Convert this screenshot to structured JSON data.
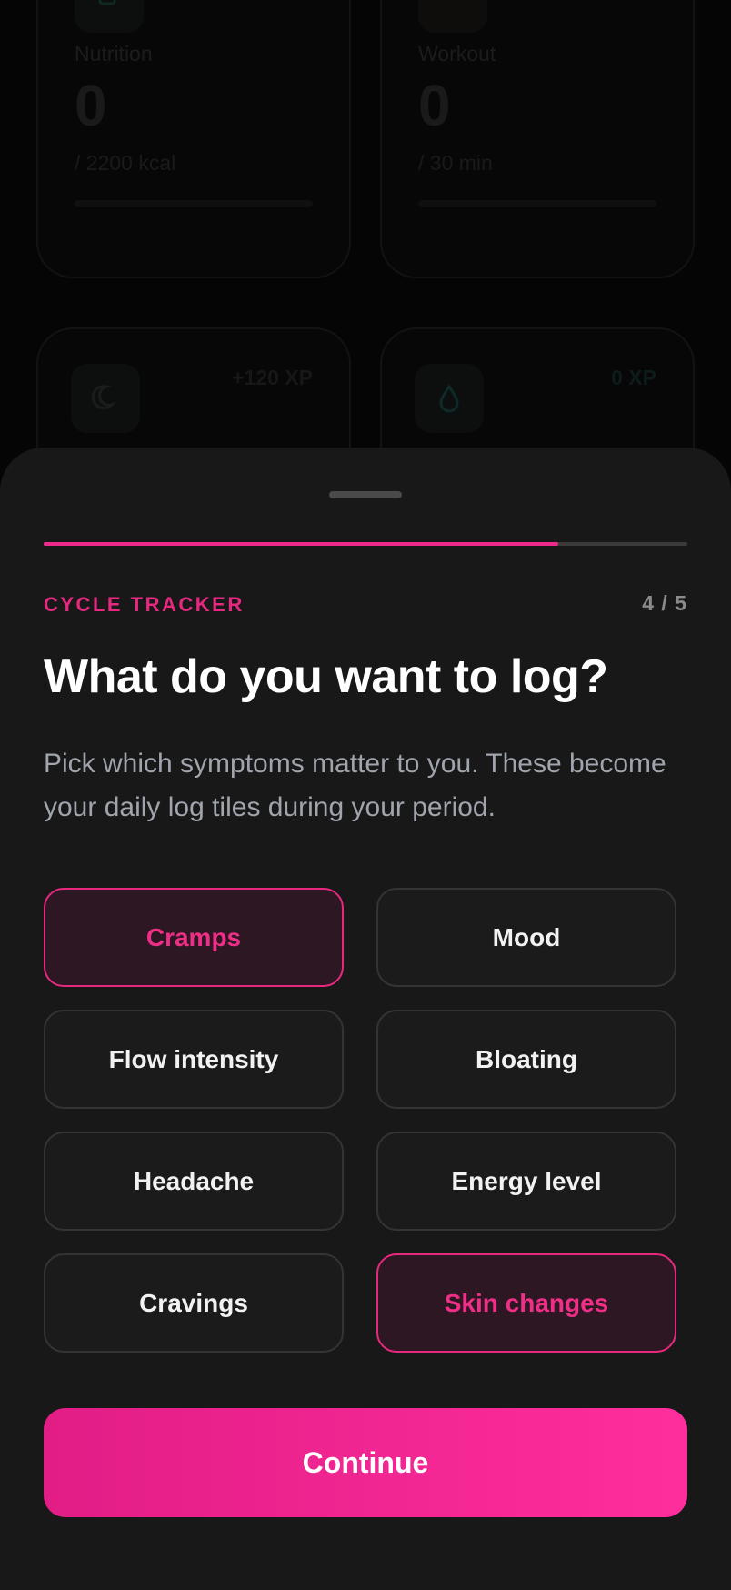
{
  "background": {
    "cards": [
      {
        "label": "Nutrition",
        "value": "0",
        "goal": "/ 2200 kcal",
        "icon": "cup-icon"
      },
      {
        "label": "Workout",
        "value": "0",
        "goal": "/ 30 min",
        "icon": "dumbbell-icon"
      }
    ],
    "xp_cards": [
      {
        "xp": "+120 XP",
        "icon": "moon-icon"
      },
      {
        "xp": "0 XP",
        "icon": "water-drop-icon"
      }
    ]
  },
  "sheet": {
    "progress": 0.8,
    "eyebrow": "CYCLE TRACKER",
    "step": "4 / 5",
    "title": "What do you want to log?",
    "subtitle": "Pick which symptoms matter to you. These become your daily log tiles during your period.",
    "options": [
      {
        "label": "Cramps",
        "selected": true
      },
      {
        "label": "Mood",
        "selected": false
      },
      {
        "label": "Flow intensity",
        "selected": false
      },
      {
        "label": "Bloating",
        "selected": false
      },
      {
        "label": "Headache",
        "selected": false
      },
      {
        "label": "Energy level",
        "selected": false
      },
      {
        "label": "Cravings",
        "selected": false
      },
      {
        "label": "Skin changes",
        "selected": true
      }
    ],
    "continue_label": "Continue"
  },
  "colors": {
    "accent": "#e8287f",
    "selected_bg": "#2c1722",
    "sheet_bg": "#181818"
  }
}
